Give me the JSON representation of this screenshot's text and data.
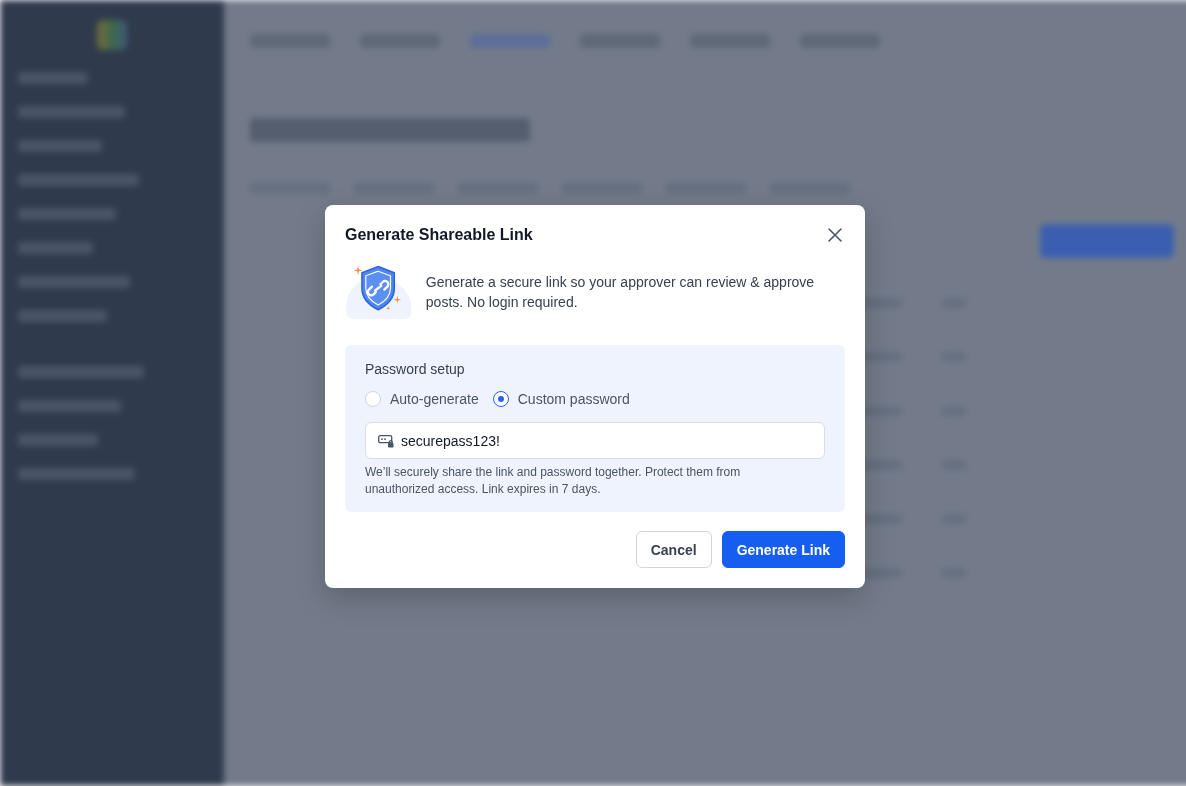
{
  "dialog": {
    "title": "Generate Shareable Link",
    "description": "Generate a secure link so your approver can review & approve posts. No login required.",
    "password": {
      "label": "Password setup",
      "options": [
        {
          "label": "Auto-generate",
          "selected": false
        },
        {
          "label": "Custom password",
          "selected": true
        }
      ],
      "field": {
        "value": "securepass123!"
      },
      "help": "We’ll securely share the link and password together. Protect them from unauthorized access. Link expires in 7 days."
    },
    "buttons": [
      {
        "label": "Cancel",
        "kind": "secondary"
      },
      {
        "label": "Generate Link",
        "kind": "primary"
      }
    ]
  }
}
